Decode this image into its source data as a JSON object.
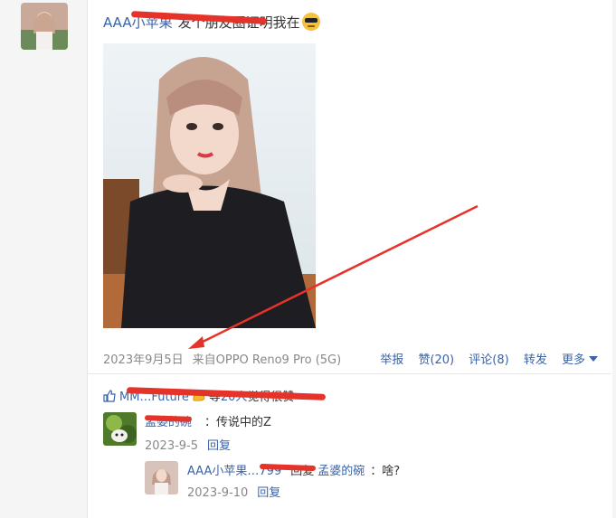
{
  "post": {
    "author": "AAA小苹果",
    "text": "发个朋友圈证明我在",
    "date": "2023年9月5日",
    "source": "来自OPPO Reno9 Pro (5G)"
  },
  "actions": {
    "report": "举报",
    "like": "赞(20)",
    "comment": "评论(8)",
    "forward": "转发",
    "more": "更多"
  },
  "likes": {
    "names": "MM…Future",
    "suffix_prefix": "等",
    "count": "20人",
    "suffix": "觉得很赞"
  },
  "comments": [
    {
      "author": "孟婆的碗",
      "text": "：传说中的Z",
      "date": "2023-9-5",
      "reply_label": "回复"
    },
    {
      "author": "AAA小苹果…799",
      "reply_word": "回复",
      "target": "孟婆的碗",
      "text": "：啥?",
      "date": "2023-9-10",
      "reply_label": "回复"
    }
  ],
  "icons": {
    "emoji": "sunglasses-emoji-icon",
    "thumb": "thumb-up-icon",
    "biceps": "flexed-biceps-emoji-icon",
    "caret": "caret-down-icon"
  },
  "colors": {
    "link": "#3a63a8",
    "muted": "#888888",
    "annotation": "#e5332a"
  }
}
